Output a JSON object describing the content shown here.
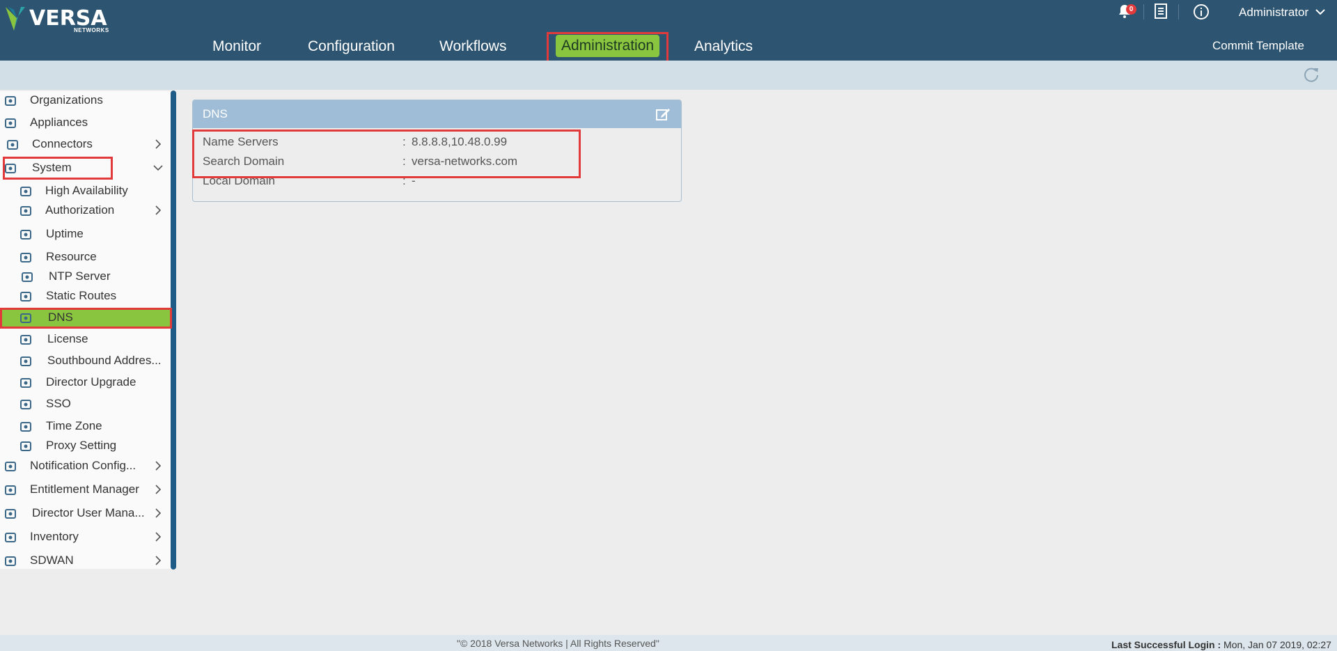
{
  "brand": {
    "name": "VERSA",
    "sub": "NETWORKS"
  },
  "nav": {
    "items": [
      {
        "label": "Monitor"
      },
      {
        "label": "Configuration"
      },
      {
        "label": "Workflows"
      },
      {
        "label": "Administration"
      },
      {
        "label": "Analytics"
      }
    ],
    "active": "Administration",
    "commit_label": "Commit Template"
  },
  "header": {
    "notification_count": "0",
    "user": "Administrator",
    "icons": [
      "bell-icon",
      "list-icon",
      "info-icon",
      "chevron-down-icon"
    ]
  },
  "sidebar": {
    "items": [
      {
        "label": "Organizations",
        "icon": "organizations-icon"
      },
      {
        "label": "Appliances",
        "icon": "appliances-icon"
      },
      {
        "label": "Connectors",
        "icon": "connector-plug-icon",
        "expand": "chevron-right"
      },
      {
        "label": "System",
        "icon": "monitor-icon",
        "expand": "chevron-down"
      },
      {
        "label": "High Availability",
        "icon": "server-icon"
      },
      {
        "label": "Authorization",
        "icon": "login-arrow-icon",
        "expand": "chevron-right"
      },
      {
        "label": "Uptime",
        "icon": "stopwatch-icon"
      },
      {
        "label": "Resource",
        "icon": "chip-icon"
      },
      {
        "label": "NTP Server",
        "icon": "ntp-server-icon"
      },
      {
        "label": "Static Routes",
        "icon": "routes-icon"
      },
      {
        "label": "DNS",
        "icon": "dns-globe-icon"
      },
      {
        "label": "License",
        "icon": "license-document-icon"
      },
      {
        "label": "Southbound Addres...",
        "icon": "southbound-document-icon"
      },
      {
        "label": "Director Upgrade",
        "icon": "upgrade-arrow-icon"
      },
      {
        "label": "SSO",
        "icon": "sso-cloud-icon"
      },
      {
        "label": "Time Zone",
        "icon": "globe-icon"
      },
      {
        "label": "Proxy Setting",
        "icon": "proxy-globe-icon"
      },
      {
        "label": "Notification Config...",
        "icon": "notification-config-icon",
        "expand": "chevron-right"
      },
      {
        "label": "Entitlement Manager",
        "icon": "gear-icon",
        "expand": "chevron-right"
      },
      {
        "label": "Director User Mana...",
        "icon": "users-icon",
        "expand": "chevron-right"
      },
      {
        "label": "Inventory",
        "icon": "inventory-icon",
        "expand": "chevron-right"
      },
      {
        "label": "SDWAN",
        "icon": "sdwan-nodes-icon",
        "expand": "chevron-right"
      }
    ],
    "selected": "DNS"
  },
  "dns_card": {
    "title": "DNS",
    "rows": [
      {
        "key": "Name Servers",
        "value": "8.8.8.8,10.48.0.99"
      },
      {
        "key": "Search Domain",
        "value": "versa-networks.com"
      },
      {
        "key": "Local Domain",
        "value": "-"
      }
    ],
    "separator": ":"
  },
  "footer": {
    "copyright": "\"© 2018 Versa Networks | All Rights Reserved\"",
    "login_label": "Last Successful Login :",
    "login_value": "Mon, Jan 07 2019, 02:27"
  },
  "colors": {
    "header": "#2d5470",
    "accent_green": "#8ac53f",
    "highlight_red": "#e23a3a",
    "card_header": "#9fbdd6"
  }
}
